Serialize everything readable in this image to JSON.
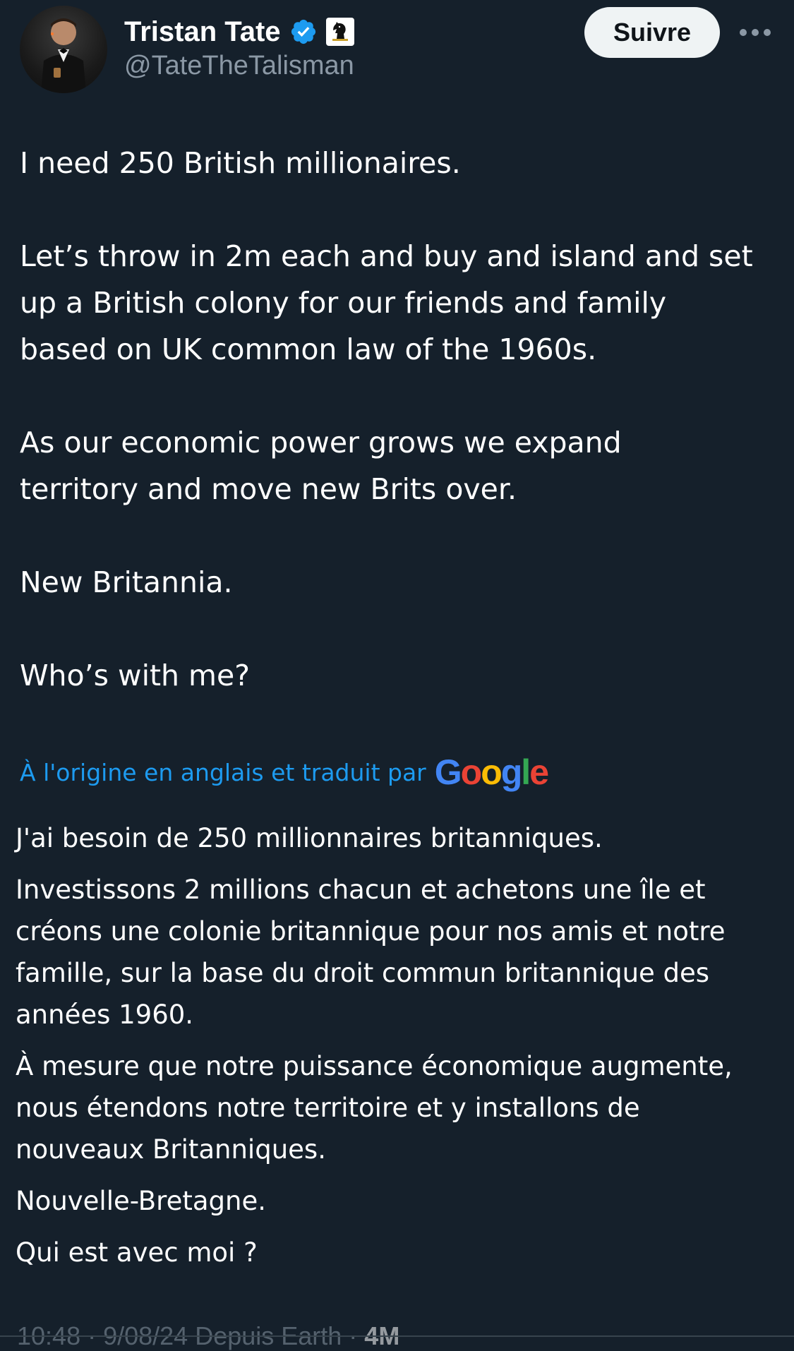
{
  "author": {
    "display_name": "Tristan Tate",
    "handle": "@TateTheTalisman",
    "verified_color": "#1d9bf0",
    "affiliate_badge_icon": "knight-chess-icon"
  },
  "actions": {
    "follow_label": "Suivre",
    "more_icon": "more-dots-icon"
  },
  "tweet": {
    "lines": [
      "I need 250 British millionaires.",
      "Let’s throw in 2m each and buy and island and set",
      "up a British colony for our friends and family",
      "based on UK common law of the 1960s.",
      "As our economic power grows we expand",
      "territory and move new Brits over.",
      "New Britannia.",
      "Who’s with me?"
    ]
  },
  "translation": {
    "label": "À l'origine en anglais et traduit par",
    "provider": "Google",
    "lines": [
      "J'ai besoin de 250 millionnaires britanniques.",
      "Investissons 2 millions chacun et achetons une île et",
      "créons une colonie britannique pour nos amis et notre",
      "famille, sur la base du droit commun britannique des",
      "années 1960.",
      "À mesure que notre puissance économique augmente,",
      "nous étendons notre territoire et y installons de",
      "nouveaux Britanniques.",
      "Nouvelle-Bretagne.",
      "Qui est avec moi ?"
    ]
  },
  "meta": {
    "timestamp": "10:48 · 9/08/24 Depuis Earth · ",
    "views": "4M"
  },
  "colors": {
    "background": "#15202b",
    "link": "#1d9bf0",
    "secondary_text": "#8b98a5"
  }
}
